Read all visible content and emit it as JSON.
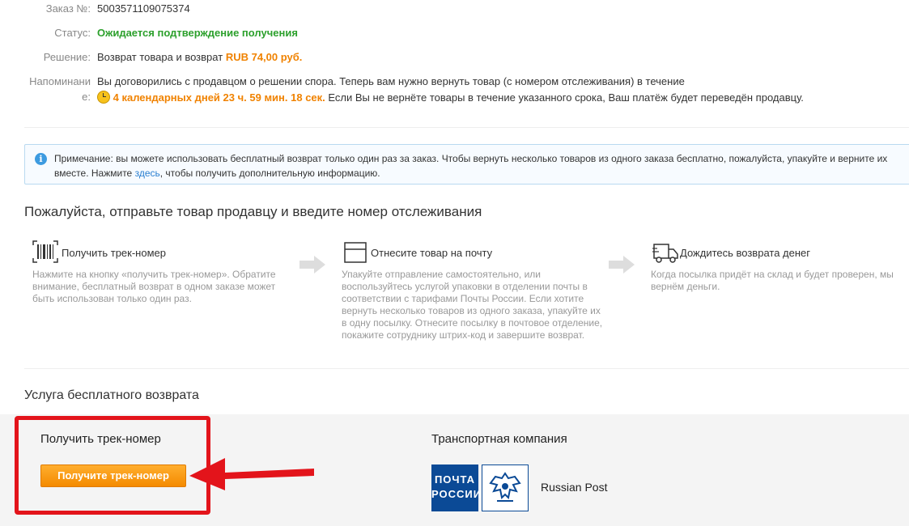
{
  "order": {
    "order_label": "Заказ №:",
    "order_number": "5003571109075374",
    "status_label": "Статус:",
    "status_value": "Ожидается подтверждение получения",
    "decision_label": "Решение:",
    "decision_prefix": "Возврат товара и возврат",
    "decision_amount": "RUB 74,00 руб.",
    "reminder_label_1": "Напоминани",
    "reminder_label_2": "е:",
    "reminder_line1": "Вы договорились с продавцом о решении спора. Теперь вам нужно вернуть товар (с номером отслеживания) в течение",
    "reminder_timer": "4 календарных дней 23 ч. 59 мин. 18 сек.",
    "reminder_line2": "Если Вы не вернёте товары в течение указанного срока, Ваш платёж будет переведён продавцу."
  },
  "notice": {
    "text_before": "Примечание: вы можете использовать бесплатный возврат только один раз за заказ. Чтобы вернуть несколько товаров из одного заказа бесплатно, пожалуйста, упакуйте и верните их вместе. Нажмите",
    "link": "здесь",
    "text_after": ", чтобы получить дополнительную информацию."
  },
  "steps_heading": "Пожалуйста, отправьте товар продавцу и введите номер отслеживания",
  "steps": [
    {
      "title": "Получить трек-номер",
      "desc": "Нажмите на кнопку «получить трек-номер». Обратите внимание, бесплатный возврат в одном заказе может быть использован только один раз.",
      "icon": "barcode-icon"
    },
    {
      "title": "Отнесите товар на почту",
      "desc": "Упакуйте отправление самостоятельно, или воспользуйтесь услугой упаковки в отделении почты в соответствии с тарифами Почты России. Если хотите вернуть несколько товаров из одного заказа, упакуйте их в одну посылку. Отнесите посылку в почтовое отделение, покажите сотруднику штрих-код и завершите возврат.",
      "icon": "box-icon"
    },
    {
      "title": "Дождитесь возврата денег",
      "desc": "Когда посылка придёт на склад и будет проверен, мы вернём деньги.",
      "icon": "truck-icon"
    }
  ],
  "free_return_heading": "Услуга бесплатного возврата",
  "get_track": {
    "title": "Получить трек-номер",
    "button": "Получите трек-номер"
  },
  "carrier": {
    "title": "Транспортная компания",
    "logo_text_1": "ПОЧТА",
    "logo_text_2": "РОССИИ",
    "name": "Russian Post"
  },
  "colors": {
    "status_green": "#2ca02c",
    "accent_orange": "#f08200",
    "highlight_red": "#e3141b",
    "post_blue": "#0b4a96"
  }
}
